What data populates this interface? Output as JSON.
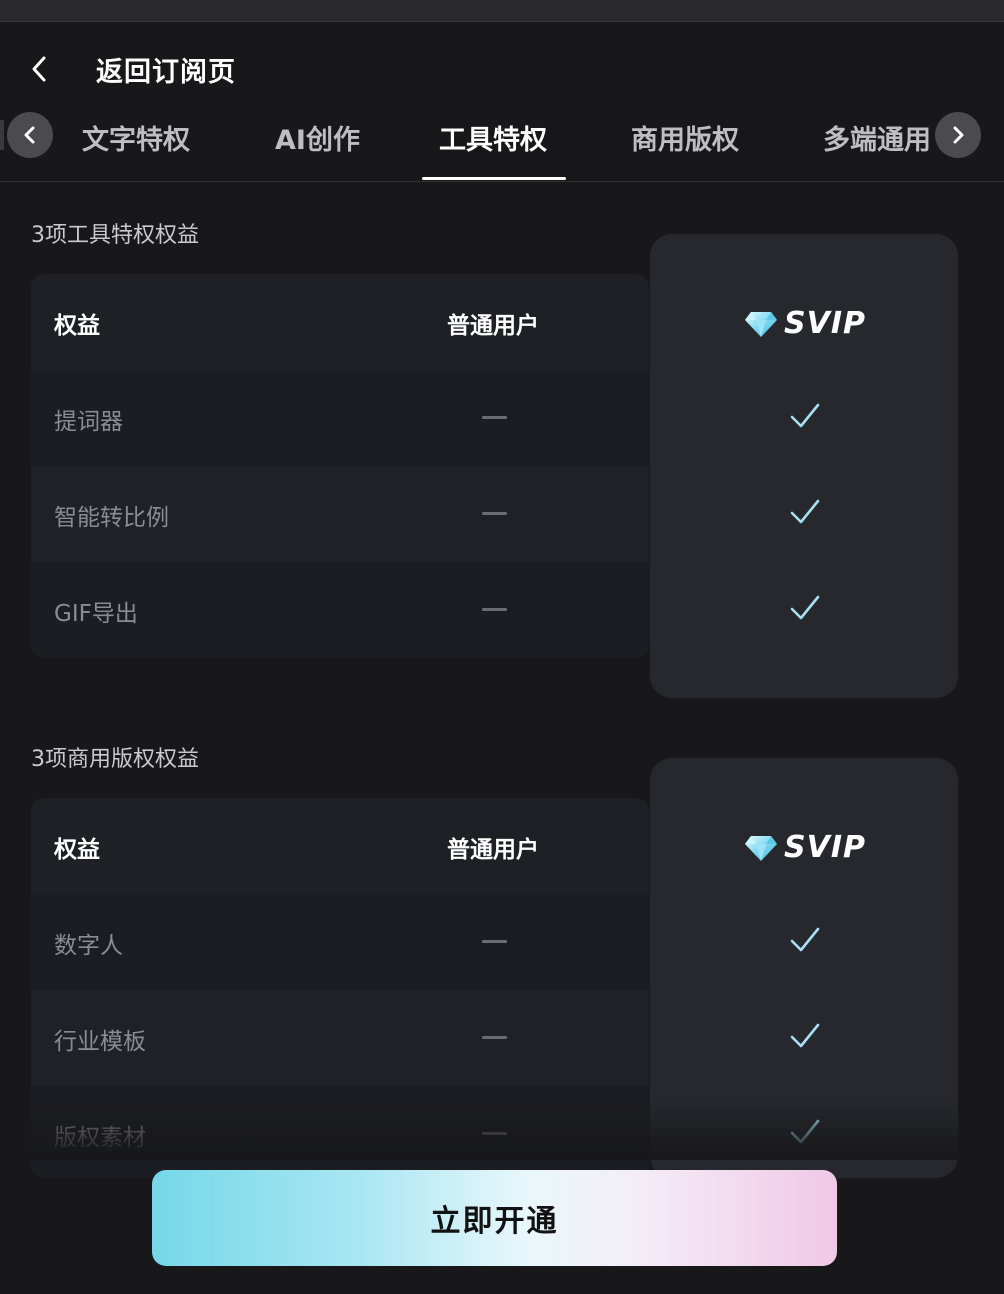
{
  "header": {
    "back_icon": "chevron-left-icon",
    "title": "返回订阅页"
  },
  "tabs": [
    {
      "label": "文字特权"
    },
    {
      "label": "AI创作"
    },
    {
      "label": "工具特权",
      "active": true
    },
    {
      "label": "商用版权"
    },
    {
      "label": "多端通用"
    }
  ],
  "sections": [
    {
      "title": "3项工具特权权益",
      "header": {
        "benefit": "权益",
        "normal": "普通用户",
        "svip": "SVIP"
      },
      "rows": [
        {
          "label": "提词器",
          "normal": "dash",
          "svip": "check"
        },
        {
          "label": "智能转比例",
          "normal": "dash",
          "svip": "check"
        },
        {
          "label": "GIF导出",
          "normal": "dash",
          "svip": "check"
        }
      ]
    },
    {
      "title": "3项商用版权权益",
      "header": {
        "benefit": "权益",
        "normal": "普通用户",
        "svip": "SVIP"
      },
      "rows": [
        {
          "label": "数字人",
          "normal": "dash",
          "svip": "check"
        },
        {
          "label": "行业模板",
          "normal": "dash",
          "svip": "check"
        },
        {
          "label": "版权素材",
          "normal": "dash",
          "svip": "check"
        }
      ]
    }
  ],
  "cta": {
    "label": "立即开通"
  },
  "colors": {
    "background": "#18181a",
    "check": "#a9dff0",
    "cta_start": "#75d8e8",
    "cta_end": "#f0c8e6"
  }
}
